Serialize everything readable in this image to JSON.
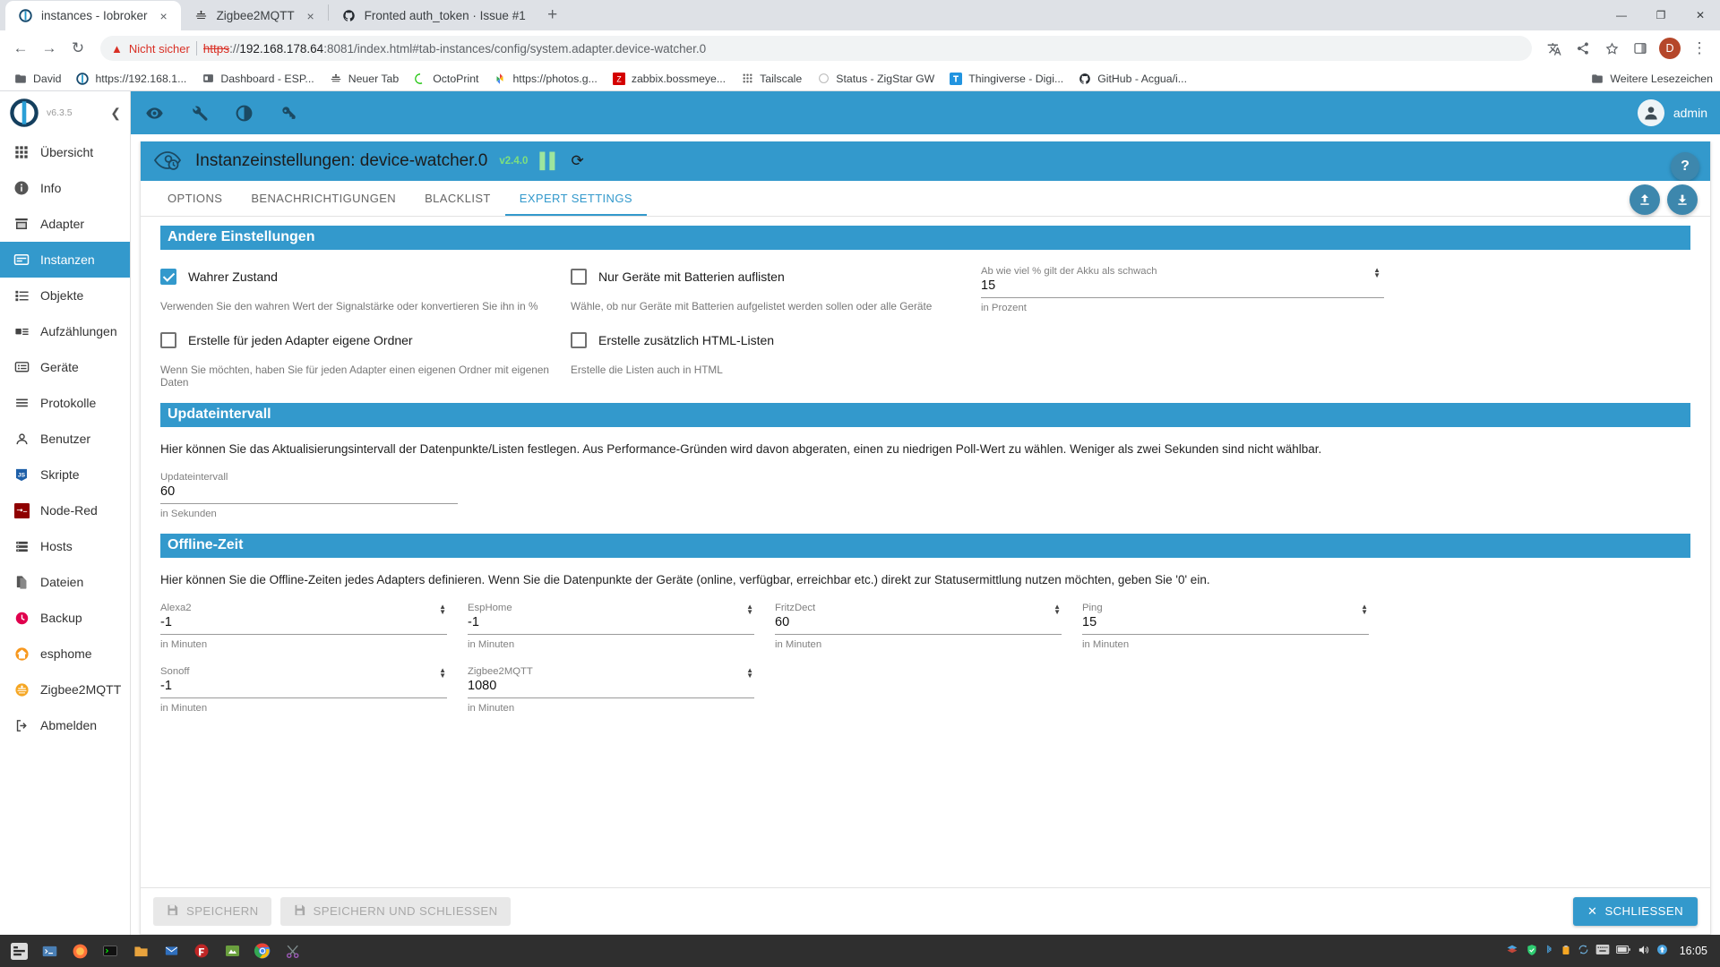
{
  "browser": {
    "tabs": [
      {
        "title": "instances - Iobroker",
        "favicon": "iobroker-icon",
        "active": true,
        "close": "×"
      },
      {
        "title": "Zigbee2MQTT",
        "favicon": "zigbee-icon",
        "active": false,
        "close": "×"
      },
      {
        "title": "Fronted auth_token · Issue #1",
        "favicon": "github-icon",
        "active": false,
        "close": "×"
      }
    ],
    "new_tab_label": "+",
    "window_controls": {
      "minimize": "—",
      "maximize": "❐",
      "close": "✕"
    },
    "nav": {
      "back": "←",
      "forward": "→",
      "reload": "↻"
    },
    "omnibox": {
      "not_secure": "Nicht sicher",
      "url_scheme": "https",
      "url_sep": "://",
      "url_host": "192.168.178.64",
      "url_rest": ":8081/index.html#tab-instances/config/system.adapter.device-watcher.0"
    },
    "toolbar_right": {
      "translate": "translate-icon",
      "share": "share-icon",
      "star": "star-icon",
      "sidepanel": "side-panel-icon",
      "profile": "D",
      "menu": "⋮"
    },
    "bookmarks": [
      {
        "label": "David",
        "icon": "folder-icon"
      },
      {
        "label": "https://192.168.1...",
        "icon": "iobroker-icon"
      },
      {
        "label": "Dashboard - ESP...",
        "icon": "dashboard-icon"
      },
      {
        "label": "Neuer Tab",
        "icon": "zigbee-icon"
      },
      {
        "label": "OctoPrint",
        "icon": "octoprint-icon"
      },
      {
        "label": "https://photos.g...",
        "icon": "photos-icon"
      },
      {
        "label": "zabbix.bossmeye...",
        "icon": "zabbix-icon"
      },
      {
        "label": "Tailscale",
        "icon": "tailscale-icon"
      },
      {
        "label": "Status - ZigStar GW",
        "icon": "zigstar-icon"
      },
      {
        "label": "Thingiverse - Digi...",
        "icon": "thingiverse-icon"
      },
      {
        "label": "GitHub - Acgua/i...",
        "icon": "github-icon"
      }
    ],
    "bookmarks_overflow": {
      "label": "Weitere Lesezeichen",
      "icon": "folder-icon"
    }
  },
  "sidebar": {
    "version": "v6.3.5",
    "collapse_icon": "chevron-left-icon",
    "items": [
      {
        "label": "Übersicht",
        "icon": "grid-icon",
        "active": false
      },
      {
        "label": "Info",
        "icon": "info-icon",
        "active": false
      },
      {
        "label": "Adapter",
        "icon": "store-icon",
        "active": false
      },
      {
        "label": "Instanzen",
        "icon": "instances-icon",
        "active": true
      },
      {
        "label": "Objekte",
        "icon": "list-icon",
        "active": false
      },
      {
        "label": "Aufzählungen",
        "icon": "enums-icon",
        "active": false
      },
      {
        "label": "Geräte",
        "icon": "devices-icon",
        "active": false
      },
      {
        "label": "Protokolle",
        "icon": "logs-icon",
        "active": false
      },
      {
        "label": "Benutzer",
        "icon": "user-icon",
        "active": false
      },
      {
        "label": "Skripte",
        "icon": "javascript-icon",
        "active": false
      },
      {
        "label": "Node-Red",
        "icon": "nodered-icon",
        "active": false
      },
      {
        "label": "Hosts",
        "icon": "hosts-icon",
        "active": false
      },
      {
        "label": "Dateien",
        "icon": "files-icon",
        "active": false
      },
      {
        "label": "Backup",
        "icon": "backup-icon",
        "active": false
      },
      {
        "label": "esphome",
        "icon": "esphome-icon",
        "active": false
      },
      {
        "label": "Zigbee2MQTT",
        "icon": "zigbee-icon",
        "active": false
      },
      {
        "label": "Abmelden",
        "icon": "logout-icon",
        "active": false
      }
    ]
  },
  "appbar": {
    "icons": [
      "eye-icon",
      "wrench-icon",
      "contrast-icon",
      "key-icon"
    ],
    "user": "admin",
    "avatar": "avatar-icon"
  },
  "panel": {
    "icon": "device-watcher-icon",
    "title": "Instanzeinstellungen: device-watcher.0",
    "version": "v2.4.0",
    "pause_icon": "pause-icon",
    "refresh_icon": "refresh-icon",
    "help_label": "?",
    "tabs": [
      {
        "label": "OPTIONS",
        "active": false
      },
      {
        "label": "BENACHRICHTIGUNGEN",
        "active": false
      },
      {
        "label": "BLACKLIST",
        "active": false
      },
      {
        "label": "EXPERT SETTINGS",
        "active": true
      }
    ],
    "tab_actions": [
      {
        "name": "upload-config-button",
        "glyph": "⤒"
      },
      {
        "name": "download-config-button",
        "glyph": "⤓"
      }
    ]
  },
  "sections": {
    "other": {
      "title": "Andere Einstellungen",
      "checkboxes": [
        {
          "label": "Wahrer Zustand",
          "checked": true,
          "helper": "Verwenden Sie den wahren Wert der Signalstärke oder konvertieren Sie ihn in %"
        },
        {
          "label": "Nur Geräte mit Batterien auflisten",
          "checked": false,
          "helper": "Wähle, ob nur Geräte mit Batterien aufgelistet werden sollen oder alle Geräte"
        },
        {
          "label": "Erstelle für jeden Adapter eigene Ordner",
          "checked": false,
          "helper": "Wenn Sie möchten, haben Sie für jeden Adapter einen eigenen Ordner mit eigenen Daten"
        },
        {
          "label": "Erstelle zusätzlich HTML-Listen",
          "checked": false,
          "helper": "Erstelle die Listen auch in HTML"
        }
      ],
      "battery_field": {
        "label": "Ab wie viel % gilt der Akku als schwach",
        "value": "15",
        "helper": "in Prozent"
      }
    },
    "update": {
      "title": "Updateintervall",
      "description": "Hier können Sie das Aktualisierungsintervall der Datenpunkte/Listen festlegen. Aus Performance-Gründen wird davon abgeraten, einen zu niedrigen Poll-Wert zu wählen. Weniger als zwei Sekunden sind nicht wählbar.",
      "field": {
        "label": "Updateintervall",
        "value": "60",
        "helper": "in Sekunden"
      }
    },
    "offline": {
      "title": "Offline-Zeit",
      "description": "Hier können Sie die Offline-Zeiten jedes Adapters definieren. Wenn Sie die Datenpunkte der Geräte (online, verfügbar, erreichbar etc.) direkt zur Statusermittlung nutzen möchten, geben Sie '0' ein.",
      "fields": [
        {
          "label": "Alexa2",
          "value": "-1",
          "helper": "in Minuten"
        },
        {
          "label": "EspHome",
          "value": "-1",
          "helper": "in Minuten"
        },
        {
          "label": "FritzDect",
          "value": "60",
          "helper": "in Minuten"
        },
        {
          "label": "Ping",
          "value": "15",
          "helper": "in Minuten"
        },
        {
          "label": "Sonoff",
          "value": "-1",
          "helper": "in Minuten"
        },
        {
          "label": "Zigbee2MQTT",
          "value": "1080",
          "helper": "in Minuten"
        }
      ]
    }
  },
  "footer": {
    "save": "SPEICHERN",
    "save_close": "SPEICHERN UND SCHLIESSEN",
    "close": "SCHLIESSEN",
    "save_icon": "save-icon",
    "close_icon": "close-icon"
  },
  "taskbar": {
    "start": "start-icon",
    "apps": [
      "terminal-icon",
      "firefox-icon",
      "console-icon",
      "files-icon",
      "mail-icon",
      "filezilla-icon",
      "gimp-icon",
      "chrome-icon",
      "scissors-icon"
    ],
    "tray": [
      "network-icon",
      "shield-icon",
      "bluetooth-icon",
      "clipboard-icon",
      "sync-icon",
      "keyboard-icon",
      "battery-icon",
      "volume-icon",
      "updates-icon"
    ],
    "clock": "16:05"
  },
  "colors": {
    "accent": "#3399cc",
    "danger": "#d93025",
    "sidebar_active": "#3399cc",
    "version_green": "#7ee07e"
  }
}
